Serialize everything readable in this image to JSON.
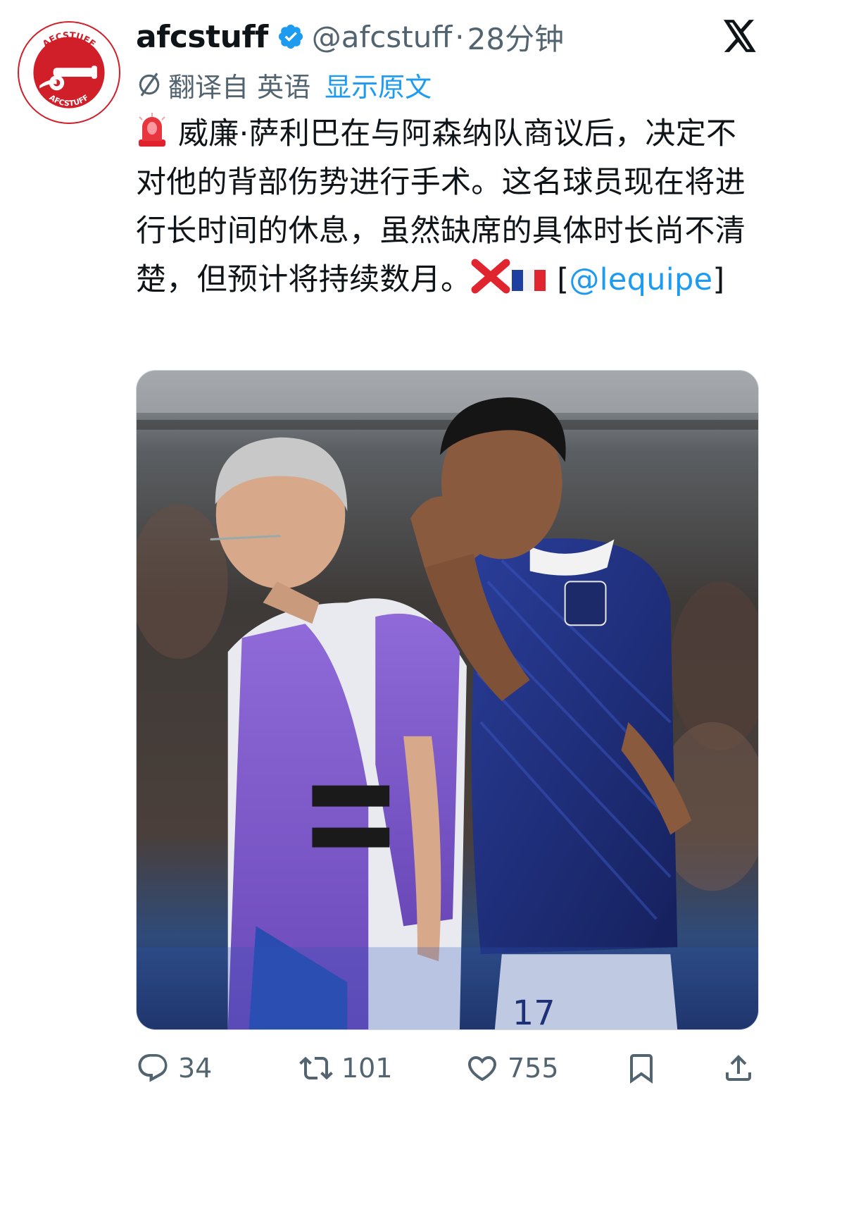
{
  "post": {
    "display_name": "afcstuff",
    "handle": "@afcstuff",
    "separator": "·",
    "time": "28分钟",
    "avatar_text": "AFCSTUFF",
    "translation": {
      "translated_from": "翻译自 英语",
      "show_original": "显示原文"
    },
    "text_before_mention": "威廉·萨利巴在与阿森纳队商议后，决定不对他的背部伤势进行手术。这名球员现在将进行长时间的休息，虽然缺席的具体时长尚不清楚，但预计将持续数月。",
    "bracket_open": "[",
    "mention": "@lequipe",
    "bracket_close": "]",
    "emojis": [
      "rotating-light",
      "cross-mark",
      "flag-france"
    ]
  },
  "photo": {
    "jersey_number": "17"
  },
  "actions": {
    "reply_count": "34",
    "retweet_count": "101",
    "like_count": "755"
  },
  "colors": {
    "accent": "#1d9bf0",
    "secondary_text": "#536471",
    "brand_red": "#d11f2a"
  }
}
